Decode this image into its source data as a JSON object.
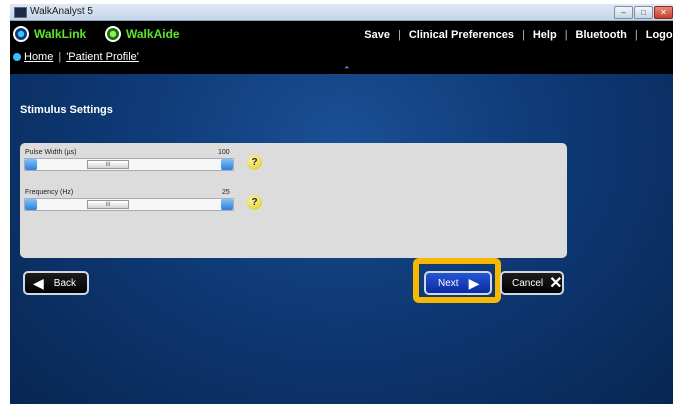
{
  "window": {
    "title": "WalkAnalyst 5",
    "controls": {
      "minimize": "–",
      "maximize": "□",
      "close": "✕"
    }
  },
  "header": {
    "logos": [
      {
        "label": "WalkLink",
        "icon": "walklink-logo-icon"
      },
      {
        "label": "WalkAide",
        "icon": "walkaide-logo-icon"
      }
    ],
    "nav": [
      "Save",
      "Clinical Preferences",
      "Help",
      "Bluetooth",
      "Logout"
    ],
    "breadcrumbs": [
      "Home",
      "'Patient Profile'"
    ],
    "collapse_glyph": "⌃"
  },
  "main": {
    "section_title": "Stimulus Settings",
    "settings": [
      {
        "label": "Pulse Width (µs)",
        "value": "100",
        "level": 0.38,
        "thumb_glyph": "III"
      },
      {
        "label": "Frequency (Hz)",
        "value": "25",
        "level": 0.38,
        "thumb_glyph": "III"
      }
    ],
    "help_glyph": "?",
    "buttons": {
      "back": "Back",
      "next": "Next",
      "cancel": "Cancel"
    },
    "arrow_glyphs": {
      "left": "◀",
      "right": "▶"
    }
  },
  "colors": {
    "accent_green": "#5fe62a",
    "highlight": "#f6b800",
    "next_blue": "#1a46c8",
    "background_blue": "#0e3a76"
  }
}
